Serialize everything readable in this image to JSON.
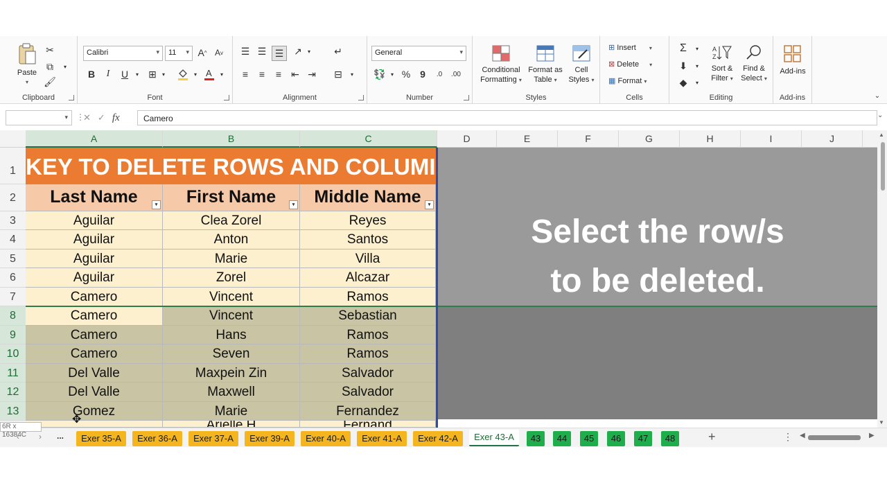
{
  "ribbon": {
    "clipboard": {
      "paste": "Paste",
      "label": "Clipboard"
    },
    "font": {
      "name": "Calibri",
      "size": "11",
      "label": "Font",
      "bold": "B",
      "italic": "I",
      "underline": "U"
    },
    "alignment": {
      "label": "Alignment"
    },
    "number": {
      "format": "General",
      "label": "Number",
      "percent": "%",
      "comma": "9"
    },
    "styles": {
      "conditional": [
        "Conditional",
        "Formatting"
      ],
      "format_table": [
        "Format as",
        "Table"
      ],
      "cell_styles": [
        "Cell",
        "Styles"
      ],
      "label": "Styles"
    },
    "cells": {
      "insert": "Insert",
      "delete": "Delete",
      "format": "Format",
      "label": "Cells"
    },
    "editing": {
      "sort": [
        "Sort &",
        "Filter"
      ],
      "find": [
        "Find &",
        "Select"
      ],
      "label": "Editing"
    },
    "addins": {
      "btn": "Add-ins",
      "label": "Add-ins"
    }
  },
  "formula_bar": {
    "name_box": "",
    "fx": "fx",
    "value": "Camero"
  },
  "columns": [
    "A",
    "B",
    "C",
    "D",
    "E",
    "F",
    "G",
    "H",
    "I",
    "J"
  ],
  "rows": [
    "1",
    "2",
    "3",
    "4",
    "5",
    "6",
    "7",
    "8",
    "9",
    "10",
    "11",
    "12",
    "13"
  ],
  "sheet": {
    "title": "KEY TO DELETE ROWS AND COLUMI",
    "headers": [
      "Last Name",
      "First Name",
      "Middle Name"
    ],
    "data": [
      [
        "Aguilar",
        "Clea Zorel",
        "Reyes"
      ],
      [
        "Aguilar",
        "Anton",
        "Santos"
      ],
      [
        "Aguilar",
        "Marie",
        "Villa"
      ],
      [
        "Aguilar",
        "Zorel",
        "Alcazar"
      ],
      [
        "Camero",
        "Vincent",
        "Ramos"
      ],
      [
        "Camero",
        "Vincent",
        "Sebastian"
      ],
      [
        "Camero",
        "Hans",
        "Ramos"
      ],
      [
        "Camero",
        "Seven",
        "Ramos"
      ],
      [
        "Del Valle",
        "Maxpein Zin",
        "Salvador"
      ],
      [
        "Del Valle",
        "Maxwell",
        "Salvador"
      ],
      [
        "Gomez",
        "Marie",
        "Fernandez"
      ]
    ],
    "partial_row": [
      "",
      "Arielle H",
      "Fernand"
    ]
  },
  "overlay": {
    "line1": "Select the row/s",
    "line2": "to be deleted."
  },
  "size_tip": "6R x 16384C",
  "tabs": {
    "nav_more": "...",
    "add": "+",
    "options": "⋮",
    "items": [
      "Exer 35-A",
      "Exer 36-A",
      "Exer 37-A",
      "Exer 39-A",
      "Exer 40-A",
      "Exer 41-A",
      "Exer 42-A",
      "Exer 43-A",
      "43",
      "44",
      "45",
      "46",
      "47",
      "48"
    ]
  },
  "colors": {
    "title": "#ec7b32",
    "header": "#f6c9a8",
    "row_light": "#fdf0cf",
    "row_selected": "#c8c4a4",
    "accent": "#217346"
  }
}
